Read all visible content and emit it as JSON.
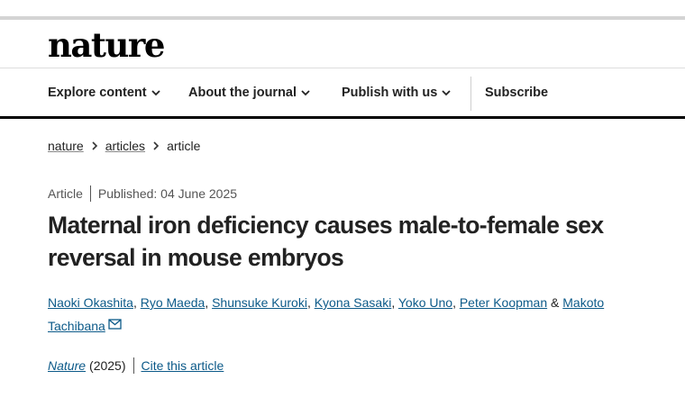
{
  "header": {
    "logo_text": "nature"
  },
  "nav": {
    "items": [
      {
        "label": "Explore content",
        "has_dropdown": true
      },
      {
        "label": "About the journal",
        "has_dropdown": true
      },
      {
        "label": "Publish with us",
        "has_dropdown": true
      },
      {
        "label": "Subscribe",
        "has_dropdown": false
      }
    ]
  },
  "breadcrumb": {
    "items": [
      "nature",
      "articles",
      "article"
    ]
  },
  "article": {
    "type": "Article",
    "published": "Published: 04 June 2025",
    "title": "Maternal iron deficiency causes male-to-female sex reversal in mouse embryos",
    "authors": [
      "Naoki Okashita",
      "Ryo Maeda",
      "Shunsuke Kuroki",
      "Kyona Sasaki",
      "Yoko Uno",
      "Peter Koopman",
      "Makoto Tachibana"
    ],
    "author_separator": ", ",
    "author_conjunction": " & ",
    "corresponding_icon": "mail-icon",
    "journal": "Nature",
    "year": "(2025)",
    "cite_label": "Cite this article"
  },
  "colors": {
    "link": "#0c5a89",
    "text": "#222222",
    "muted": "#555555"
  }
}
